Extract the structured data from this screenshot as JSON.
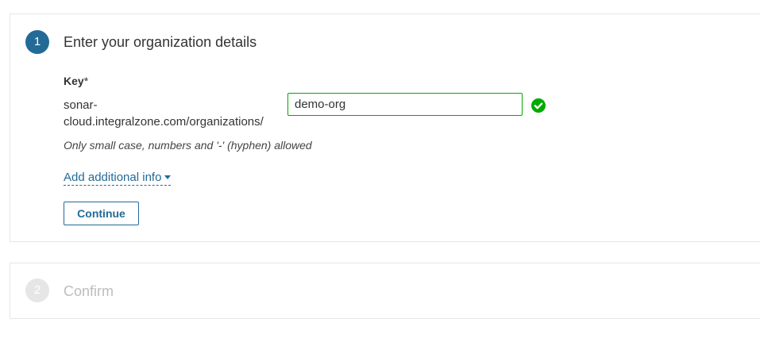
{
  "steps": [
    {
      "number": "1",
      "title": "Enter your organization details",
      "active": true,
      "key_label": "Key",
      "required_mark": "*",
      "url_prefix": "sonar-cloud.integralzone.com/organizations/",
      "key_value": "demo-org",
      "hint": "Only small case, numbers and '-' (hyphen) allowed",
      "add_info_label": "Add additional info",
      "continue_label": "Continue"
    },
    {
      "number": "2",
      "title": "Confirm",
      "active": false
    }
  ],
  "icons": {
    "valid": "check-circle-icon",
    "dropdown": "caret-down-icon"
  },
  "colors": {
    "accent": "#236a97",
    "valid": "#00aa00",
    "disabled": "#bdbdbd"
  }
}
